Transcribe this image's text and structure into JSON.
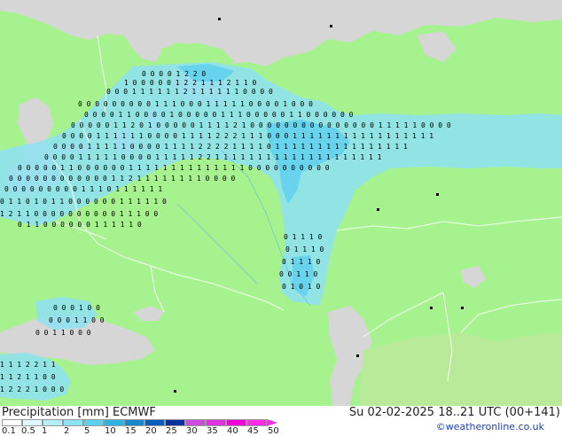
{
  "footer": {
    "title": "Precipitation [mm] ECMWF",
    "datetime": "Su 02-02-2025 18..21 UTC (00+141)",
    "credit": "©weatheronline.co.uk"
  },
  "legend": {
    "labels": [
      "0.1",
      "0.5",
      "1",
      "2",
      "5",
      "10",
      "15",
      "20",
      "25",
      "30",
      "35",
      "40",
      "45",
      "50"
    ],
    "colors": [
      "#ffffff",
      "#e0f8ff",
      "#b4eefa",
      "#8ce4f5",
      "#5dd0ee",
      "#2fb4e4",
      "#1989cf",
      "#0a5cb8",
      "#06329e",
      "#c850d8",
      "#e033e0",
      "#f000d8",
      "#ff2be6"
    ]
  },
  "map": {
    "colors": {
      "land": "#a6f28e",
      "sea": "#d6d6d6",
      "border": "#ffffff",
      "precip_light": "#c9f3fb",
      "precip_medium": "#8de2f2",
      "precip_heavy": "#5fd0ee"
    }
  }
}
